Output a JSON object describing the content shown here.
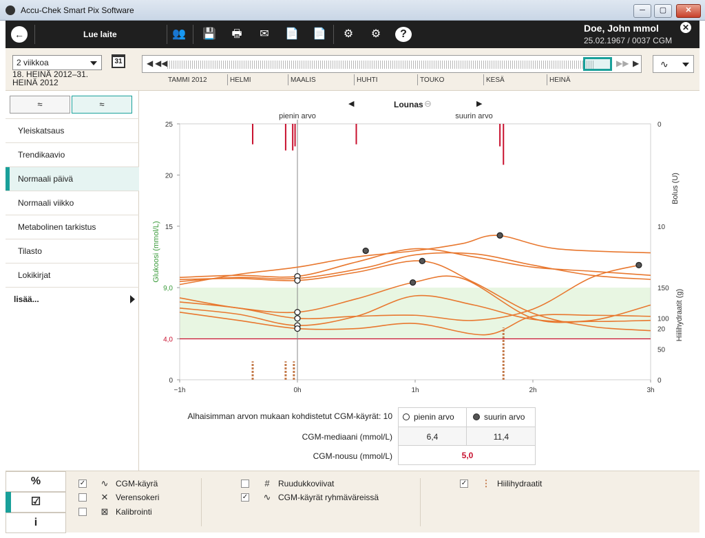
{
  "window": {
    "title": "Accu-Chek Smart Pix Software",
    "min": "─",
    "max": "▢",
    "close": "✕"
  },
  "toolbar": {
    "back": "←",
    "read_device": "Lue laite",
    "icons": {
      "users": "👥",
      "save": "💾",
      "print": "🖶",
      "email": "✉",
      "pdf1": "📄",
      "pdf2": "📄",
      "settings": "⚙",
      "device_settings": "⚙",
      "help": "?"
    },
    "patient_name": "Doe, John mmol",
    "patient_info": "25.02.1967 / 0037 CGM",
    "close": "✕"
  },
  "period": {
    "select_value": "2 viikkoa",
    "range": "18. HEINÄ 2012–31. HEINÄ 2012",
    "calendar_day": "31"
  },
  "timeline": {
    "months": [
      "TAMMI 2012",
      "HELMI",
      "MAALIS",
      "HUHTI",
      "TOUKO",
      "KESÄ",
      "HEINÄ"
    ],
    "prev": "◀",
    "first": "◀◀",
    "next": "▶▶",
    "last": "▶"
  },
  "curve_button": "∿",
  "mode_buttons": [
    "≈",
    "≈"
  ],
  "nav": {
    "items": [
      "Yleiskatsaus",
      "Trendikaavio",
      "Normaali päivä",
      "Normaali viikko",
      "Metabolinen tarkistus",
      "Tilasto",
      "Lokikirjat"
    ],
    "active_index": 2,
    "more": "lisää..."
  },
  "chart_nav": {
    "label": "Lounas",
    "prev": "◀",
    "next": "▶"
  },
  "chart_data": {
    "type": "line",
    "annotations": [
      "pienin arvo",
      "suurin arvo"
    ],
    "ylabel_left": "Glukoosi (mmol/L)",
    "ylabel_right_top": "Bolus (U)",
    "ylabel_right_bottom": "Hiilihydraatit (g)",
    "x_ticks": [
      "−1h",
      "0h",
      "1h",
      "2h",
      "3h"
    ],
    "xlim": [
      -1,
      3
    ],
    "y_ticks_left": [
      "0",
      "4,0",
      "9,0",
      "15",
      "20",
      "25"
    ],
    "y_tick_values_left": [
      0,
      4,
      9,
      15,
      20,
      25
    ],
    "ylim": [
      0,
      25
    ],
    "bolus_ticks": [
      "0",
      "10",
      "20"
    ],
    "carb_ticks": [
      "0",
      "50",
      "100",
      "150"
    ],
    "target_range": [
      4,
      9
    ],
    "hypo_line": 4,
    "series": [
      {
        "x": [
          -1,
          -0.5,
          0,
          0.5,
          1,
          1.5,
          2,
          2.5,
          3
        ],
        "values": [
          10.0,
          10.2,
          10.1,
          11.5,
          12.8,
          12.0,
          11.0,
          10.6,
          10.2
        ]
      },
      {
        "x": [
          -1,
          -0.5,
          0,
          0.6,
          1.0,
          1.5,
          2,
          2.5,
          3
        ],
        "values": [
          9.6,
          10.0,
          9.9,
          11.0,
          12.2,
          12.3,
          11.2,
          10.2,
          9.8
        ]
      },
      {
        "x": [
          -1,
          -0.5,
          0,
          0.5,
          1.06,
          1.5,
          2,
          2.5,
          3
        ],
        "values": [
          9.8,
          9.9,
          9.7,
          10.5,
          11.6,
          9.5,
          6.5,
          5.2,
          4.8
        ]
      },
      {
        "x": [
          -1,
          -0.5,
          0,
          0.5,
          1.0,
          1.4,
          1.7,
          2.2,
          3
        ],
        "values": [
          9.3,
          10.3,
          11.0,
          12.0,
          12.6,
          13.3,
          14.1,
          12.8,
          12.4
        ]
      },
      {
        "x": [
          -1,
          -0.5,
          0,
          0.5,
          0.98,
          1.4,
          2.0,
          2.5,
          3
        ],
        "values": [
          8.0,
          7.0,
          6.6,
          7.9,
          9.5,
          9.9,
          6.0,
          5.7,
          5.8
        ]
      },
      {
        "x": [
          -1,
          -0.5,
          0,
          0.5,
          1.0,
          1.5,
          2.0,
          2.5,
          2.9
        ],
        "values": [
          7.6,
          7.0,
          6.0,
          6.2,
          6.3,
          5.8,
          6.9,
          10.0,
          11.2
        ]
      },
      {
        "x": [
          -1,
          -0.5,
          0,
          0.5,
          1.0,
          1.5,
          2.0,
          2.5,
          3
        ],
        "values": [
          7.0,
          6.4,
          5.3,
          6.2,
          8.2,
          7.3,
          5.9,
          5.8,
          7.3
        ]
      },
      {
        "x": [
          -1,
          -0.5,
          0,
          0.5,
          1.0,
          1.6,
          2.0,
          2.5,
          3
        ],
        "values": [
          6.6,
          5.8,
          5.0,
          5.0,
          5.5,
          4.4,
          6.2,
          6.3,
          6.2
        ]
      }
    ],
    "min_points": {
      "x": [
        0,
        0,
        0,
        0,
        0,
        0
      ],
      "values": [
        10.1,
        9.7,
        6.6,
        6.0,
        5.3,
        5.0
      ]
    },
    "max_points": {
      "x": [
        0.58,
        1.06,
        1.72,
        0.98,
        2.9
      ],
      "values": [
        12.6,
        11.6,
        14.1,
        9.5,
        11.2
      ]
    },
    "bolus_x": [
      -0.38,
      -0.1,
      -0.04,
      -0.02,
      0.5,
      1.72,
      1.75
    ],
    "bolus_values": [
      2.0,
      2.6,
      2.6,
      2.2,
      2.0,
      2.2,
      4.0
    ],
    "carb_x": [
      -0.38,
      -0.1,
      -0.03,
      1.75
    ],
    "carb_values": [
      30,
      30,
      30,
      85
    ]
  },
  "stats": {
    "aligned_label": "Alhaisimman arvon mukaan kohdistetut CGM-käyrät: 10",
    "min_label": "pienin arvo",
    "max_label": "suurin arvo",
    "median_label": "CGM-mediaani (mmol/L)",
    "median_min": "6,4",
    "median_max": "11,4",
    "rise_label": "CGM-nousu (mmol/L)",
    "rise_value": "5,0"
  },
  "bottom": {
    "tabs": [
      "%",
      "☑",
      "i"
    ],
    "options": [
      {
        "label": "CGM-käyrä",
        "checked": true,
        "icon": "∿"
      },
      {
        "label": "Verensokeri",
        "checked": false,
        "icon": "✕"
      },
      {
        "label": "Kalibrointi",
        "checked": false,
        "icon": "⊠"
      },
      {
        "label": "Ruudukkoviivat",
        "checked": false,
        "icon": "#"
      },
      {
        "label": "CGM-käyrät ryhmäväreissä",
        "checked": true,
        "icon": "∿"
      },
      {
        "label": "Hiilihydraatit",
        "checked": true,
        "icon": "⋮"
      }
    ]
  },
  "colors": {
    "accent": "#19a09a",
    "curve": "#e8772e",
    "target": "#e8f6e2",
    "hypo": "#c8102e",
    "carb": "#c47a4a"
  }
}
